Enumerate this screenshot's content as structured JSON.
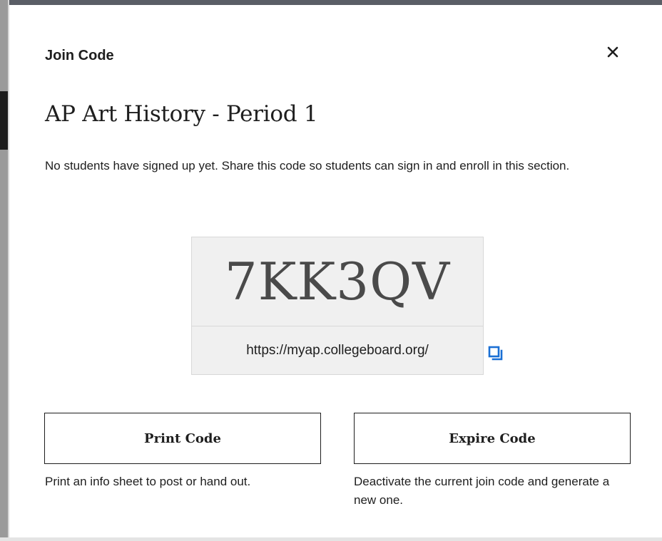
{
  "dialog": {
    "header_title": "Join Code",
    "section_title": "AP Art History - Period 1",
    "description": "No students have signed up yet. Share this code so students can sign in and enroll in this section.",
    "close_icon": "close-icon"
  },
  "join_code": {
    "code": "7KK3QV",
    "url": "https://myap.collegeboard.org/",
    "copy_icon": "copy-icon",
    "copy_icon_color": "#1a6fd4"
  },
  "actions": {
    "print": {
      "label": "Print Code",
      "helper": "Print an info sheet to post or hand out."
    },
    "expire": {
      "label": "Expire Code",
      "helper": "Deactivate the current join code and generate a new one."
    }
  }
}
